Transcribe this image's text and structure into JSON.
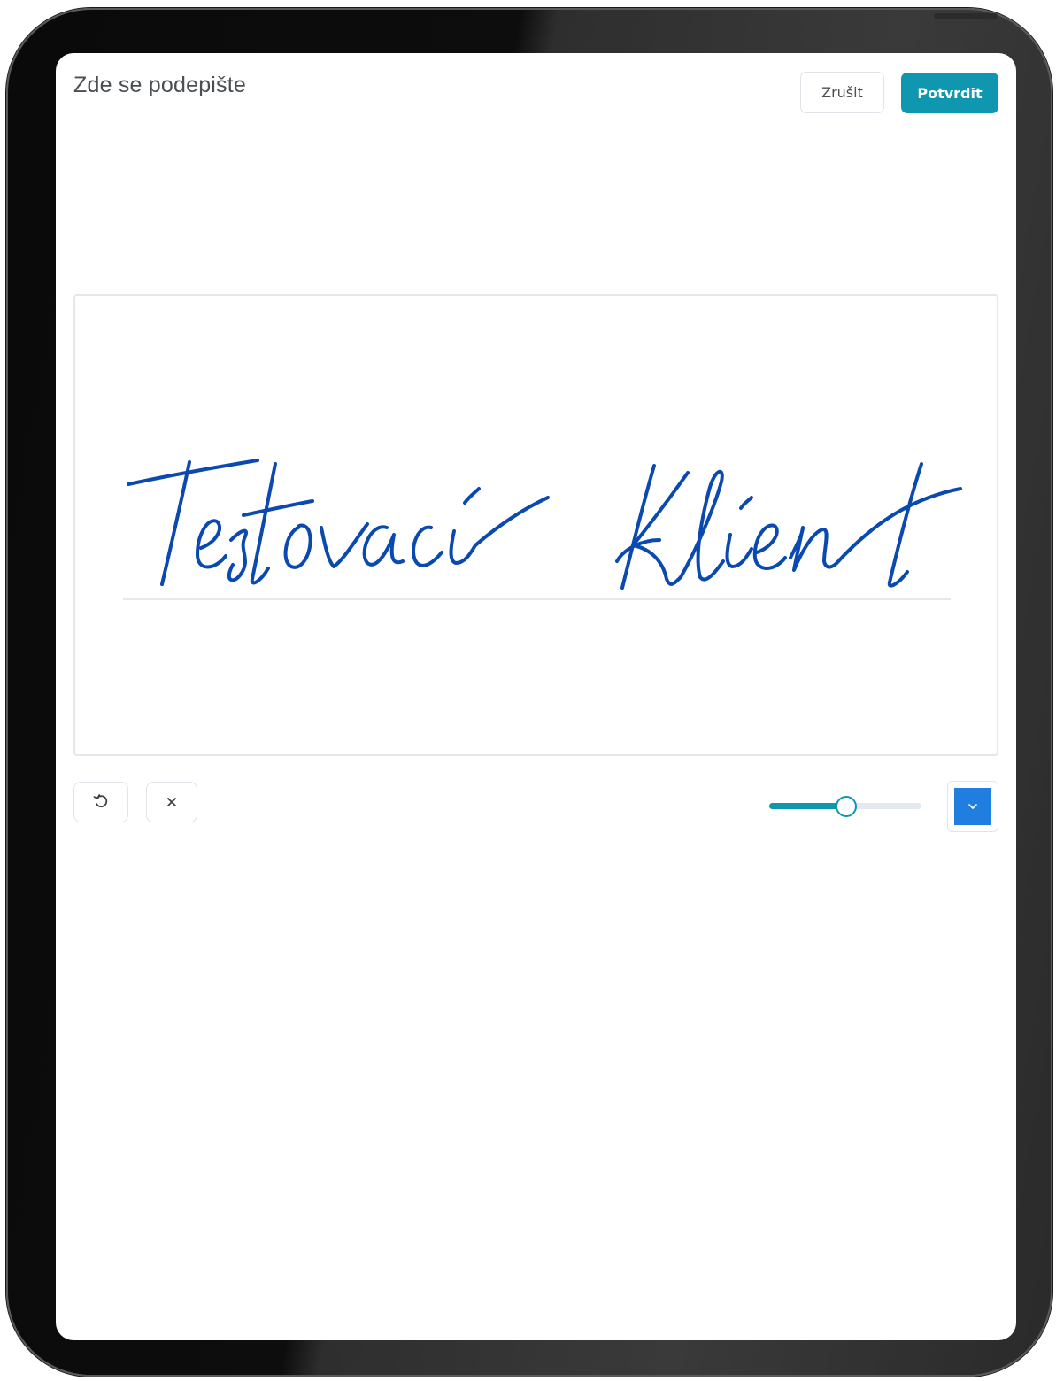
{
  "header": {
    "title": "Zde se podepište",
    "cancel_label": "Zrušit",
    "confirm_label": "Potvrdit"
  },
  "signature": {
    "text": "Testovaci Klient",
    "ink_color": "#0a49b0"
  },
  "toolbar": {
    "undo_icon": "undo-icon",
    "clear_icon": "close-icon",
    "pen_width_fraction": 0.5,
    "pen_color": "#1f7ee0",
    "color_picker_icon": "chevron-down-icon"
  },
  "colors": {
    "accent": "#0f97b0",
    "border": "#e1e4e8",
    "text": "#4a4f55"
  }
}
